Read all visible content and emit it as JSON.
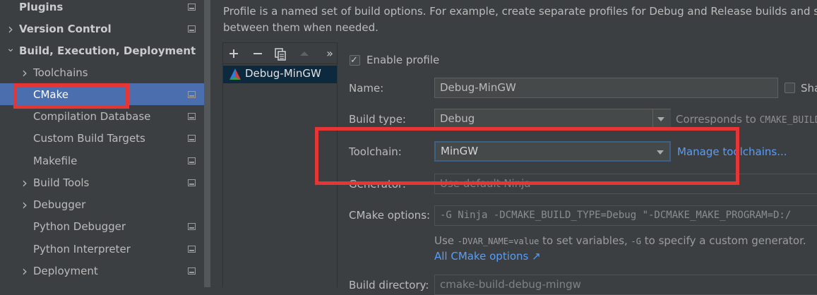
{
  "sidebar": {
    "items": [
      {
        "label": "Plugins",
        "bold": true,
        "chevron": "",
        "level": 0
      },
      {
        "label": "Version Control",
        "bold": true,
        "chevron": "chevron-right",
        "level": 0
      },
      {
        "label": "Build, Execution, Deployment",
        "bold": true,
        "chevron": "chevron-down",
        "level": 0
      },
      {
        "label": "Toolchains",
        "bold": false,
        "chevron": "chevron-right",
        "level": 1
      },
      {
        "label": "CMake",
        "bold": false,
        "chevron": "",
        "level": 1,
        "selected": true
      },
      {
        "label": "Compilation Database",
        "bold": false,
        "chevron": "",
        "level": 1
      },
      {
        "label": "Custom Build Targets",
        "bold": false,
        "chevron": "",
        "level": 1
      },
      {
        "label": "Makefile",
        "bold": false,
        "chevron": "",
        "level": 1
      },
      {
        "label": "Build Tools",
        "bold": false,
        "chevron": "chevron-right",
        "level": 1
      },
      {
        "label": "Debugger",
        "bold": false,
        "chevron": "chevron-right",
        "level": 1
      },
      {
        "label": "Python Debugger",
        "bold": false,
        "chevron": "",
        "level": 1
      },
      {
        "label": "Python Interpreter",
        "bold": false,
        "chevron": "",
        "level": 1
      },
      {
        "label": "Deployment",
        "bold": false,
        "chevron": "chevron-right",
        "level": 1
      }
    ]
  },
  "description": {
    "line1": "Profile is a named set of build options. For example, create separate profiles for Debug and Release builds and switc",
    "line2": "between them when needed."
  },
  "profiles": {
    "toolbar": {
      "add": "+",
      "remove": "−",
      "copy": "copy-icon",
      "move_up": "up-icon",
      "more": "»"
    },
    "items": [
      "Debug-MinGW"
    ]
  },
  "form": {
    "enable_profile": {
      "label": "Enable profile",
      "checked": true
    },
    "name": {
      "label": "Name:",
      "value": "Debug-MinGW",
      "share_label": "Sha"
    },
    "build_type": {
      "label": "Build type:",
      "value": "Debug",
      "hint_prefix": "Corresponds to ",
      "hint_code": "CMAKE_BUILD"
    },
    "toolchain": {
      "label": "Toolchain:",
      "value": "MinGW",
      "manage_link": "Manage toolchains..."
    },
    "generator": {
      "label": "Generator:",
      "value": "Use default  Ninja"
    },
    "cmake_options": {
      "label": "CMake options:",
      "value": "-G Ninja -DCMAKE_BUILD_TYPE=Debug \"-DCMAKE_MAKE_PROGRAM=D:/"
    },
    "cmake_hint": {
      "use": "Use ",
      "code1": "-DVAR_NAME=value",
      "middle": " to set variables, ",
      "code2": "-G",
      "end": " to specify a custom generator."
    },
    "all_options_link": "All CMake options ↗",
    "build_directory": {
      "label": "Build directory:",
      "value": "cmake-build-debug-mingw"
    }
  },
  "colors": {
    "accent": "#4b6eaf",
    "annotation": "#e53535",
    "link": "#589df6"
  }
}
